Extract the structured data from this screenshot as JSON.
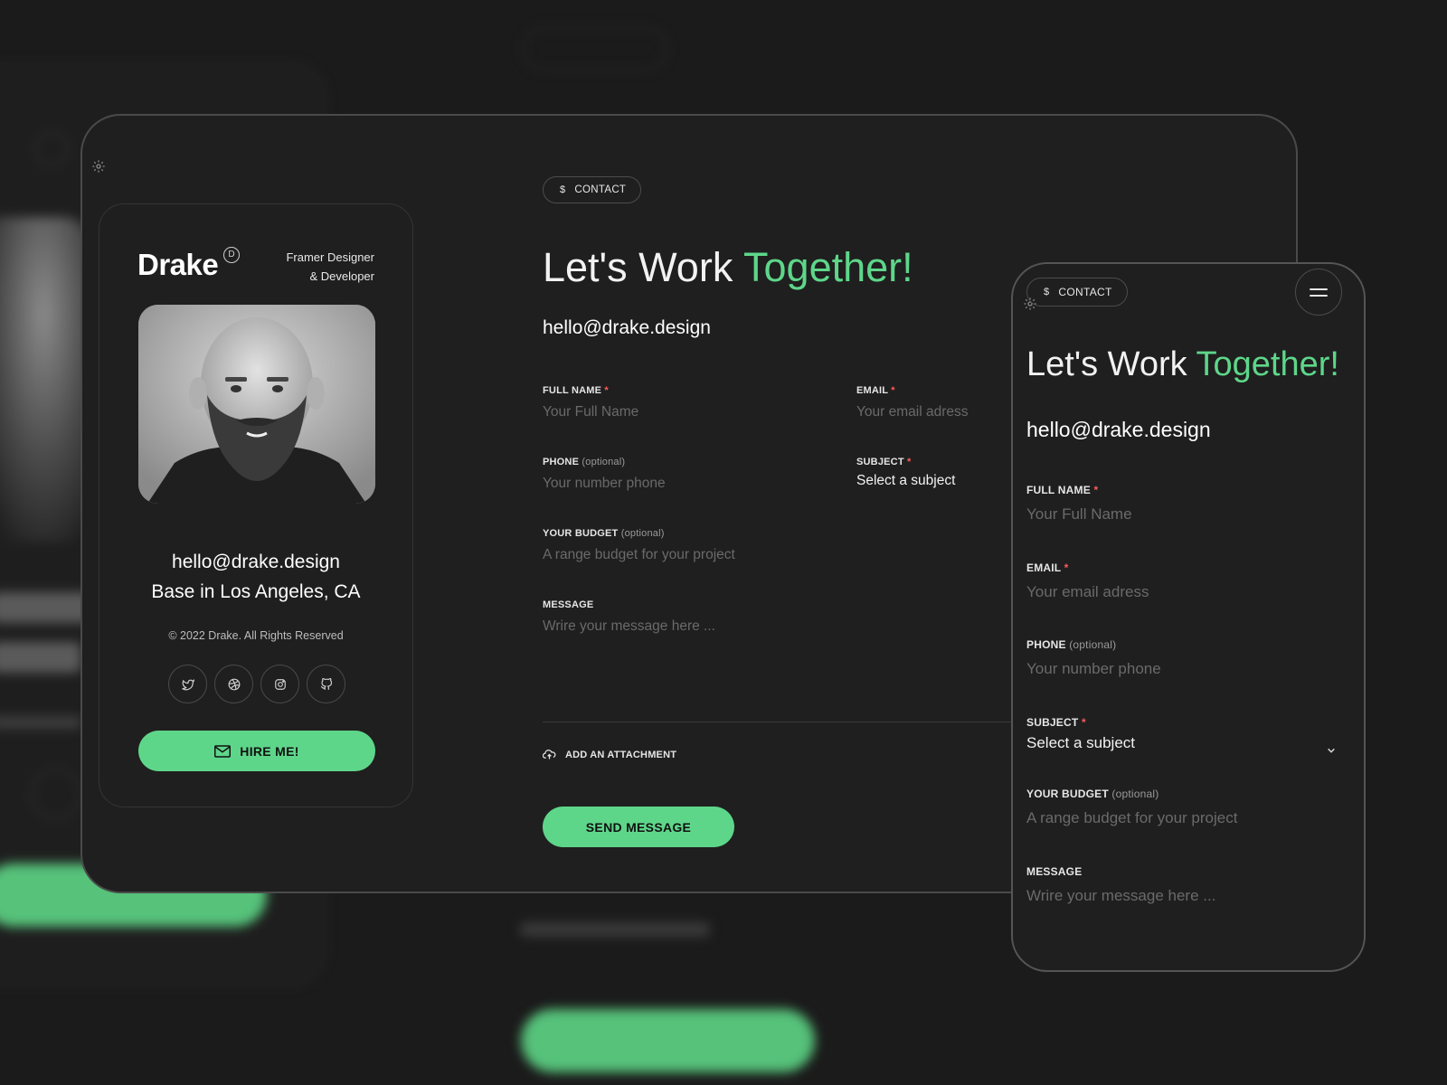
{
  "colors": {
    "accent": "#5ed68a",
    "background": "#1b1b1b",
    "required": "#ff5a5a"
  },
  "profile": {
    "brand": "Drake",
    "badge": "D",
    "role_line1": "Framer Designer",
    "role_line2": "& Developer",
    "email": "hello@drake.design",
    "location": "Base in Los Angeles, CA",
    "copyright": "© 2022 Drake. All Rights Reserved",
    "socials": [
      "twitter-icon",
      "dribbble-icon",
      "instagram-icon",
      "github-icon"
    ],
    "hire_label": "HIRE ME!"
  },
  "contact": {
    "pill_icon": "$",
    "pill_label": "CONTACT",
    "heading_part1": "Let's Work ",
    "heading_part2": "Together!",
    "email": "hello@drake.design",
    "fields": {
      "full_name": {
        "label": "FULL NAME",
        "required": "*",
        "placeholder": "Your Full Name"
      },
      "email": {
        "label": "EMAIL",
        "required": "*",
        "placeholder": "Your email adress"
      },
      "phone": {
        "label": "PHONE",
        "optional": "(optional)",
        "placeholder": "Your number phone"
      },
      "subject": {
        "label": "SUBJECT",
        "required": "*",
        "value": "Select a subject"
      },
      "budget": {
        "label": "YOUR BUDGET",
        "optional": "(optional)",
        "placeholder": "A range budget for your project"
      },
      "message": {
        "label": "MESSAGE",
        "placeholder": "Wrire your message here ..."
      }
    },
    "attach_label": "ADD AN ATTACHMENT",
    "send_label": "SEND MESSAGE"
  }
}
